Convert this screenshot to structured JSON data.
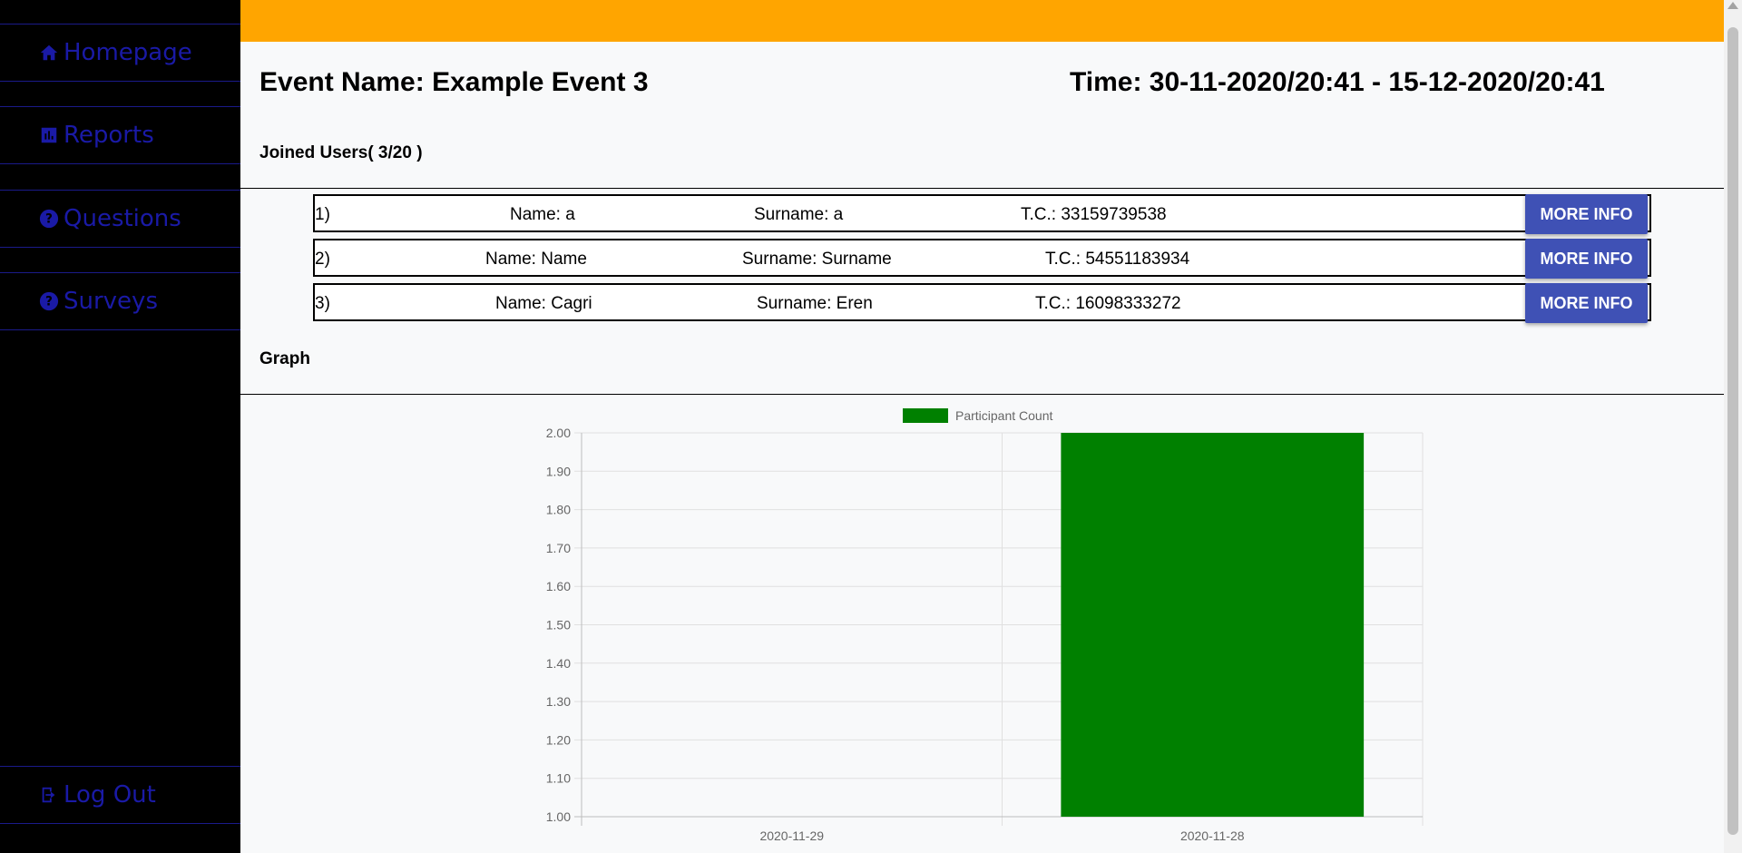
{
  "sidebar": {
    "items": [
      {
        "label": "Homepage",
        "icon": "home-icon"
      },
      {
        "label": "Reports",
        "icon": "chart-icon"
      },
      {
        "label": "Questions",
        "icon": "question-icon"
      },
      {
        "label": "Surveys",
        "icon": "question-icon"
      },
      {
        "label": "Log Out",
        "icon": "logout-icon"
      }
    ]
  },
  "event": {
    "name": "Event Name: Example Event 3",
    "time": "Time: 30-11-2020/20:41 - 15-12-2020/20:41"
  },
  "joined": {
    "title": "Joined Users( 3/20 )",
    "users": [
      {
        "index": "1)",
        "name": "Name: a",
        "surname": "Surname: a",
        "tc": "T.C.: 33159739538",
        "button": "MORE INFO"
      },
      {
        "index": "2)",
        "name": "Name: Name",
        "surname": "Surname: Surname",
        "tc": "T.C.: 54551183934",
        "button": "MORE INFO"
      },
      {
        "index": "3)",
        "name": "Name: Cagri",
        "surname": "Surname: Eren",
        "tc": "T.C.: 16098333272",
        "button": "MORE INFO"
      }
    ]
  },
  "graph": {
    "title": "Graph"
  },
  "chart_data": {
    "type": "bar",
    "categories": [
      "2020-11-29",
      "2020-11-28"
    ],
    "series": [
      {
        "name": "Participant Count",
        "values": [
          1,
          2
        ],
        "color": "#008000"
      }
    ],
    "ylim": [
      1,
      2
    ],
    "yticks": [
      "2.00",
      "1.90",
      "1.80",
      "1.70",
      "1.60",
      "1.50",
      "1.40",
      "1.30",
      "1.20",
      "1.10",
      "1.00"
    ],
    "legend": "top",
    "grid": true
  },
  "colors": {
    "topbar": "#ffa500",
    "sidebar": "#000000",
    "nav_text": "#1a1aa6",
    "button": "#3f51b5",
    "bar": "#008000"
  }
}
